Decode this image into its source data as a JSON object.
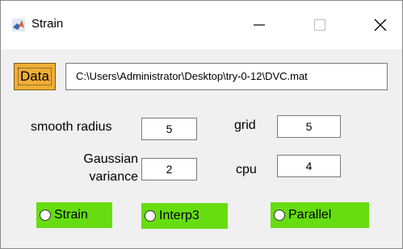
{
  "window": {
    "title": "Strain",
    "minimize_glyph": "—",
    "close_glyph": "✕"
  },
  "data_button": {
    "label": "Data"
  },
  "path_field": {
    "value": "C:\\Users\\Administrator\\Desktop\\try-0-12\\DVC.mat"
  },
  "params": {
    "smooth_radius": {
      "label": "smooth radius",
      "value": "5"
    },
    "grid": {
      "label": "grid",
      "value": "5"
    },
    "gaussian_variance": {
      "label_line1": "Gaussian",
      "label_line2": "variance",
      "value": "2"
    },
    "cpu": {
      "label": "cpu",
      "value": "4"
    }
  },
  "radios": {
    "strain": {
      "label": "Strain",
      "selected": false
    },
    "interp3": {
      "label": "Interp3",
      "selected": false
    },
    "parallel": {
      "label": "Parallel",
      "selected": false
    }
  },
  "colors": {
    "data_button_bg": "#f2ae35",
    "radio_bg": "#66dd11",
    "window_bg": "#f0f0f0",
    "titlebar_bg": "#ffffff"
  },
  "icons": {
    "app_icon": "matlab-logo-icon",
    "minimize": "minimize-icon",
    "maximize": "maximize-icon",
    "close": "close-icon"
  }
}
